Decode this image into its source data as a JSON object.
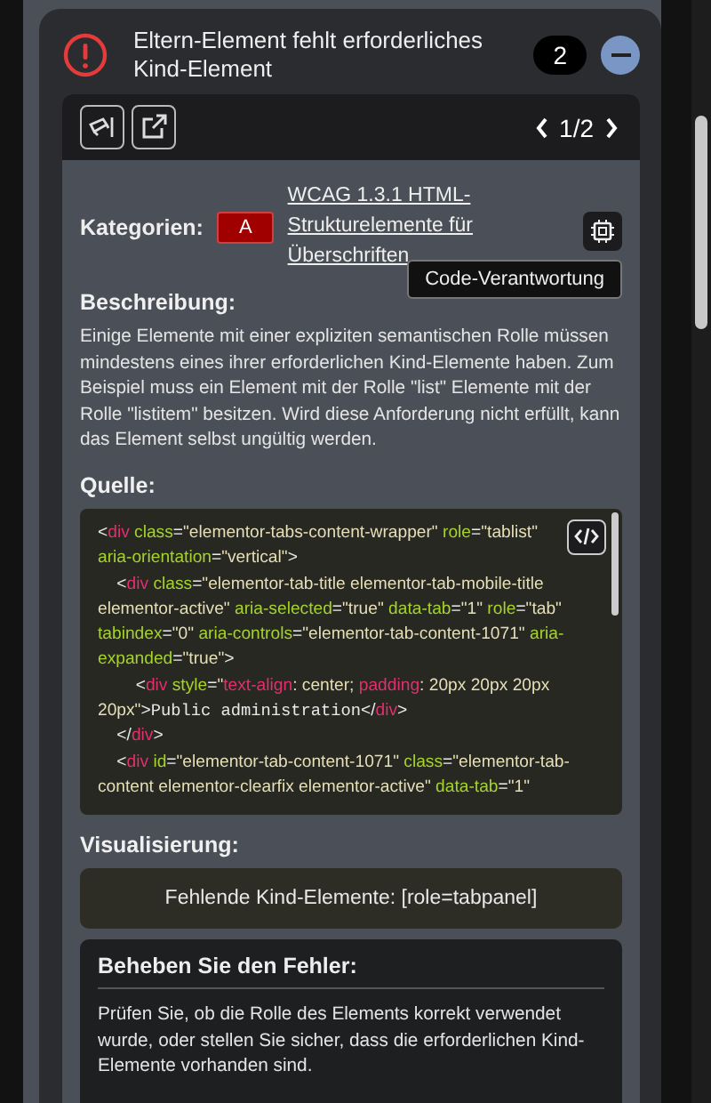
{
  "issue": {
    "title": "Eltern-Element fehlt erforderliches Kind-Element",
    "count": "2",
    "expanded": true
  },
  "pager": {
    "current": "1/2"
  },
  "categories": {
    "label": "Kategorien:",
    "level": "A",
    "link": "WCAG 1.3.1 HTML-Strukturelemente für Überschriften",
    "tooltip": "Code-Verantwortung"
  },
  "description": {
    "heading": "Beschreibung:",
    "text": "Einige Elemente mit einer expliziten semantischen Rolle müssen mindestens eines ihrer erforderlichen Kind-Elemente haben. Zum Beispiel muss ein Element mit der Rolle \"list\" Elemente mit der Rolle \"listitem\" besitzen. Wird diese Anforderung nicht erfüllt, kann das Element selbst ungültig werden."
  },
  "source": {
    "heading": "Quelle:",
    "lines": [
      [
        {
          "kind": "punct",
          "text": "<"
        },
        {
          "kind": "tag",
          "text": "div"
        },
        {
          "kind": "attr",
          "text": " class"
        },
        {
          "kind": "punct",
          "text": "="
        },
        {
          "kind": "str",
          "text": "\"elementor-tabs-content-wrapper\""
        },
        {
          "kind": "attr",
          "text": " role"
        },
        {
          "kind": "punct",
          "text": "="
        },
        {
          "kind": "str",
          "text": "\"tablist\""
        }
      ],
      [
        {
          "kind": "attr",
          "text": "aria-orientation"
        },
        {
          "kind": "punct",
          "text": "="
        },
        {
          "kind": "str",
          "text": "\"vertical\""
        },
        {
          "kind": "punct",
          "text": ">"
        }
      ],
      [
        {
          "kind": "punct",
          "text": "    <"
        },
        {
          "kind": "tag",
          "text": "div"
        },
        {
          "kind": "attr",
          "text": " class"
        },
        {
          "kind": "punct",
          "text": "="
        },
        {
          "kind": "str",
          "text": "\"elementor-tab-title elementor-tab-mobile-title"
        }
      ],
      [
        {
          "kind": "str",
          "text": "elementor-active\""
        },
        {
          "kind": "attr",
          "text": " aria-selected"
        },
        {
          "kind": "punct",
          "text": "="
        },
        {
          "kind": "str",
          "text": "\"true\""
        },
        {
          "kind": "attr",
          "text": " data-tab"
        },
        {
          "kind": "punct",
          "text": "="
        },
        {
          "kind": "str",
          "text": "\"1\""
        },
        {
          "kind": "attr",
          "text": " role"
        },
        {
          "kind": "punct",
          "text": "="
        },
        {
          "kind": "str",
          "text": "\"tab\""
        }
      ],
      [
        {
          "kind": "attr",
          "text": "tabindex"
        },
        {
          "kind": "punct",
          "text": "="
        },
        {
          "kind": "str",
          "text": "\"0\""
        },
        {
          "kind": "attr",
          "text": " aria-controls"
        },
        {
          "kind": "punct",
          "text": "="
        },
        {
          "kind": "str",
          "text": "\"elementor-tab-content-1071\""
        },
        {
          "kind": "attr",
          "text": " aria-"
        }
      ],
      [
        {
          "kind": "attr",
          "text": "expanded"
        },
        {
          "kind": "punct",
          "text": "="
        },
        {
          "kind": "str",
          "text": "\"true\""
        },
        {
          "kind": "punct",
          "text": ">"
        }
      ],
      [
        {
          "kind": "punct",
          "text": "        <"
        },
        {
          "kind": "tag",
          "text": "div"
        },
        {
          "kind": "attr",
          "text": " style"
        },
        {
          "kind": "punct",
          "text": "="
        },
        {
          "kind": "str",
          "text": "\""
        },
        {
          "kind": "tag",
          "text": "text-align"
        },
        {
          "kind": "str",
          "text": ": center; "
        },
        {
          "kind": "tag",
          "text": "padding"
        },
        {
          "kind": "str",
          "text": ": 20px 20px 20px"
        }
      ],
      [
        {
          "kind": "str",
          "text": "20px\""
        },
        {
          "kind": "punct",
          "text": ">"
        },
        {
          "kind": "mono",
          "text": "Public administration"
        },
        {
          "kind": "punct",
          "text": "</"
        },
        {
          "kind": "tag",
          "text": "div"
        },
        {
          "kind": "punct",
          "text": ">"
        }
      ],
      [
        {
          "kind": "punct",
          "text": "    </"
        },
        {
          "kind": "tag",
          "text": "div"
        },
        {
          "kind": "punct",
          "text": ">"
        }
      ],
      [
        {
          "kind": "punct",
          "text": "    <"
        },
        {
          "kind": "tag",
          "text": "div"
        },
        {
          "kind": "attr",
          "text": " id"
        },
        {
          "kind": "punct",
          "text": "="
        },
        {
          "kind": "str",
          "text": "\"elementor-tab-content-1071\""
        },
        {
          "kind": "attr",
          "text": " class"
        },
        {
          "kind": "punct",
          "text": "="
        },
        {
          "kind": "str",
          "text": "\"elementor-tab-"
        }
      ],
      [
        {
          "kind": "str",
          "text": "content elementor-clearfix elementor-active\""
        },
        {
          "kind": "attr",
          "text": " data-tab"
        },
        {
          "kind": "punct",
          "text": "="
        },
        {
          "kind": "str",
          "text": "\"1\""
        }
      ]
    ]
  },
  "visualization": {
    "heading": "Visualisierung:",
    "text": "Fehlende Kind-Elemente: [role=tabpanel]"
  },
  "fix": {
    "heading": "Beheben Sie den Fehler:",
    "text": "Prüfen Sie, ob die Rolle des Elements korrekt verwendet wurde, oder stellen Sie sicher, dass die erforderlichen Kind-Elemente vorhanden sind."
  }
}
